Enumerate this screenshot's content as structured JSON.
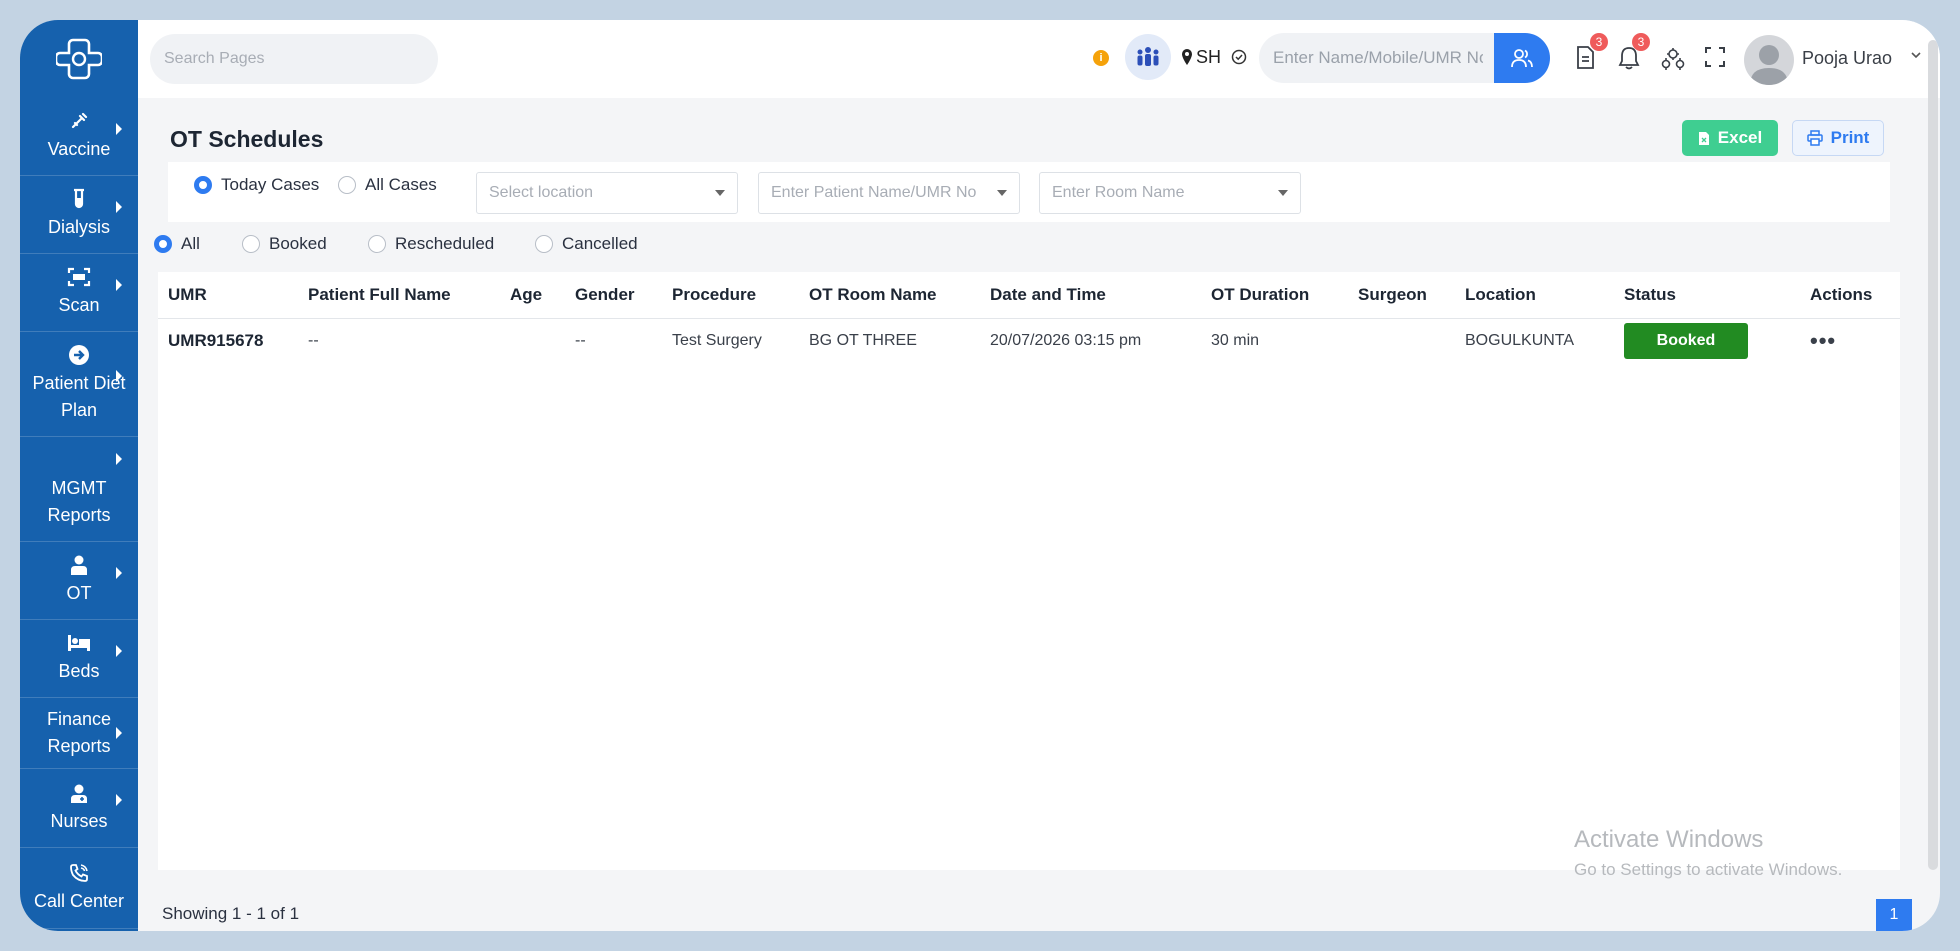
{
  "topbar": {
    "search_placeholder": "Search Pages",
    "location_code": "SH",
    "umr_placeholder": "Enter Name/Mobile/UMR No",
    "doc_badge": "3",
    "bell_badge": "3",
    "user_name": "Pooja Urao"
  },
  "sidebar": {
    "items": [
      {
        "label": "Vaccine",
        "icon": "syringe-icon"
      },
      {
        "label": "Dialysis",
        "icon": "test-tube-icon"
      },
      {
        "label": "Scan",
        "icon": "scan-icon"
      },
      {
        "label": "Patient Diet Plan",
        "icon": "arrow-circle-icon"
      },
      {
        "label": "MGMT Reports",
        "icon": ""
      },
      {
        "label": "OT",
        "icon": "doctor-icon"
      },
      {
        "label": "Beds",
        "icon": "bed-icon"
      },
      {
        "label": "Finance Reports",
        "icon": ""
      },
      {
        "label": "Nurses",
        "icon": "nurse-icon"
      },
      {
        "label": "Call Center",
        "icon": "phone-icon"
      }
    ]
  },
  "page": {
    "title": "OT Schedules",
    "excel_label": "Excel",
    "print_label": "Print"
  },
  "filters": {
    "case_options": [
      "Today Cases",
      "All Cases"
    ],
    "selected_case": "Today Cases",
    "location_placeholder": "Select location",
    "patient_placeholder": "Enter Patient Name/UMR No",
    "room_placeholder": "Enter Room Name",
    "status_options": [
      "All",
      "Booked",
      "Rescheduled",
      "Cancelled"
    ],
    "selected_status": "All"
  },
  "table": {
    "headers": [
      "UMR",
      "Patient Full Name",
      "Age",
      "Gender",
      "Procedure",
      "OT Room Name",
      "Date and Time",
      "OT Duration",
      "Surgeon",
      "Location",
      "Status",
      "Actions"
    ],
    "rows": [
      {
        "umr": "UMR915678",
        "patient_name": "--",
        "age": "",
        "gender": "--",
        "procedure": "Test Surgery",
        "room": "BG OT THREE",
        "datetime": "20/07/2026 03:15 pm",
        "duration": "30 min",
        "surgeon": "",
        "location": "BOGULKUNTA",
        "status": "Booked",
        "actions": "•••"
      }
    ]
  },
  "footer": {
    "showing": "Showing 1 - 1 of 1",
    "page": "1"
  },
  "watermark": {
    "line1": "Activate Windows",
    "line2": "Go to Settings to activate Windows."
  },
  "colors": {
    "sidebar": "#1661ad",
    "primary": "#2e7bf0",
    "excel": "#3fce91",
    "booked": "#228b22"
  }
}
